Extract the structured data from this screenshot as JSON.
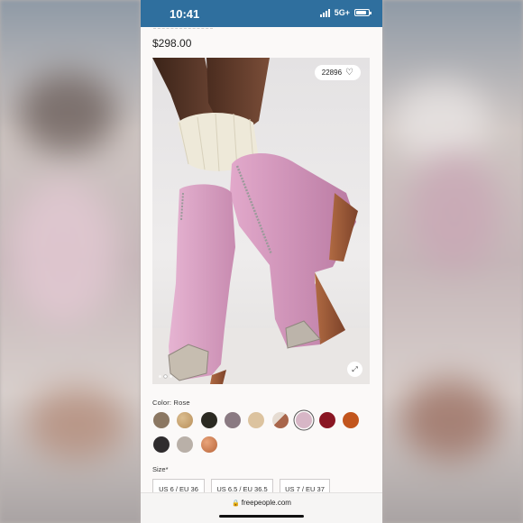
{
  "status_bar": {
    "time": "10:41",
    "network": "5G+"
  },
  "product": {
    "price": "$298.00",
    "likes": "22896",
    "carousel": {
      "count": 3,
      "active": 1
    }
  },
  "colors": {
    "label": "Color: Rose",
    "swatches": [
      {
        "name": "taupe",
        "color": "#8b7762"
      },
      {
        "name": "tan",
        "color": "#c7a170"
      },
      {
        "name": "black",
        "color": "#2b2a22"
      },
      {
        "name": "mauve",
        "color": "#8a7a82"
      },
      {
        "name": "beige",
        "color": "#dcc39f"
      },
      {
        "name": "multi",
        "color": "#a8654a"
      },
      {
        "name": "rose",
        "color": "#d7b6c6",
        "selected": true
      },
      {
        "name": "burgundy",
        "color": "#8a1623"
      },
      {
        "name": "orange",
        "color": "#c2551d"
      },
      {
        "name": "charcoal",
        "color": "#2f2c2e"
      },
      {
        "name": "grey",
        "color": "#b9b0a8"
      },
      {
        "name": "copper",
        "color": "#c9774a"
      }
    ]
  },
  "sizes": {
    "label": "Size*",
    "options": [
      "US 6 / EU 36",
      "US 6.5 / EU 36.5",
      "US 7 / EU 37"
    ]
  },
  "browser": {
    "url": "freepeople.com"
  }
}
